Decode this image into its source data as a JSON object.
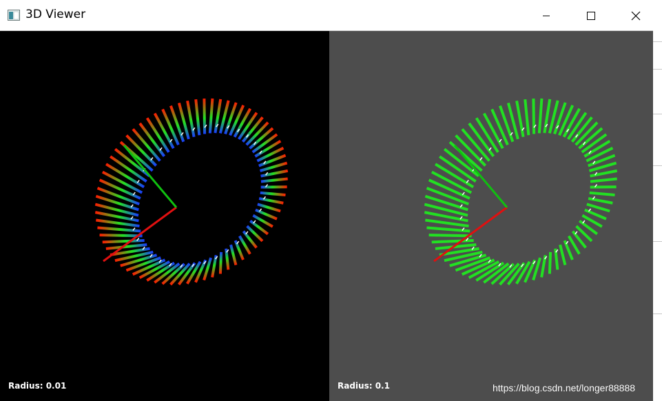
{
  "window": {
    "title": "3D Viewer",
    "controls": {
      "minimize": "minimize",
      "maximize": "maximize",
      "close": "close"
    }
  },
  "viewports": [
    {
      "label": "Radius: 0.01",
      "background": "#000000",
      "normals_style": "rgb-gradient"
    },
    {
      "label": "Radius: 0.1",
      "background": "#4d4d4d",
      "normals_style": "green"
    }
  ],
  "axes": {
    "x_color": "#e01010",
    "y_color": "#10c010"
  },
  "colors": {
    "red": "#ff1a00",
    "green": "#22e022",
    "blue": "#1a3cff",
    "point": "#ffffff"
  },
  "watermark": "https://blog.csdn.net/longer88888"
}
